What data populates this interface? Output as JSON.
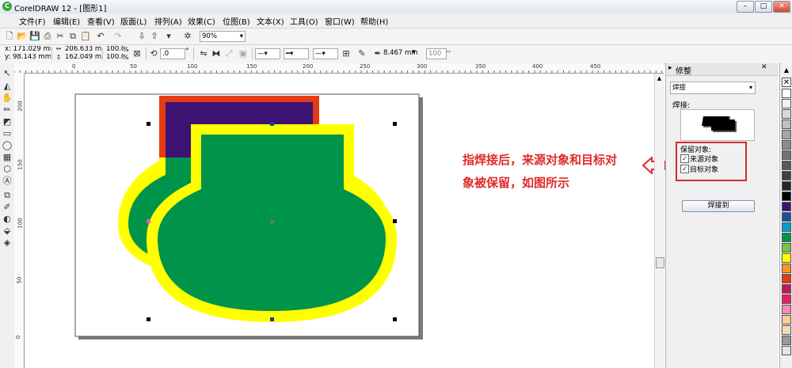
{
  "window": {
    "title": "CorelDRAW 12 - [图形1]",
    "min": "–",
    "max": "□",
    "close": "✕"
  },
  "menu": [
    "文件(F)",
    "编辑(E)",
    "查看(V)",
    "版面(L)",
    "排列(A)",
    "效果(C)",
    "位图(B)",
    "文本(X)",
    "工具(O)",
    "窗口(W)",
    "帮助(H)"
  ],
  "toolbar": {
    "zoom": "90%"
  },
  "property_bar": {
    "x": "x: 171.029 mm",
    "y": "y: 98.143 mm",
    "w": "206.633 mr",
    "h": "162.049 mr",
    "scale_w": "100.0",
    "scale_h": "100.0",
    "pct": "%",
    "angle": ".0",
    "degree": "°",
    "outline_width": "8.467 mm",
    "fill_level": "100"
  },
  "ruler_h_labels": [
    "0",
    "50",
    "100",
    "150",
    "200",
    "250",
    "300",
    "350",
    "400",
    "450"
  ],
  "ruler_v_labels": [
    "200",
    "150",
    "100",
    "50",
    "0"
  ],
  "docker": {
    "title": "修整",
    "mode": "焊接",
    "section_label": "焊接:",
    "keep_label": "保留对象:",
    "options": [
      {
        "label": "来源对象",
        "checked": true
      },
      {
        "label": "目标对象",
        "checked": true
      }
    ],
    "apply_button": "焊接到"
  },
  "annotation": {
    "line1": "指焊接后，来源对象和目标对",
    "line2": "象被保留，如图所示"
  },
  "colors": {
    "accent_red": "#e02a2a",
    "shape_green": "#00934a",
    "shape_yellow": "#ffff00",
    "shape_orange": "#e43b12",
    "shape_purple": "#3c1273"
  },
  "palette": [
    "#ffffff",
    "#f2f2f2",
    "#d9d9d9",
    "#bfbfbf",
    "#a6a6a6",
    "#8c8c8c",
    "#737373",
    "#595959",
    "#404040",
    "#262626",
    "#000000",
    "#3c1273",
    "#1a4fa0",
    "#00a0c8",
    "#00934a",
    "#7cc242",
    "#ffff00",
    "#f7941d",
    "#e43b12",
    "#c2185b",
    "#e91e63",
    "#f48fb1",
    "#ffcc99",
    "#f5deb3",
    "#999999",
    "#e6e6e6"
  ]
}
